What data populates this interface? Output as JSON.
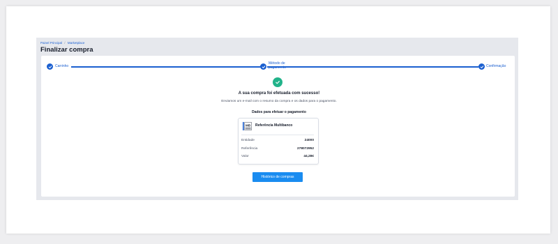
{
  "breadcrumb": {
    "items": [
      "Painel Principal",
      "Marketplace"
    ],
    "separator": "/"
  },
  "page_title": "Finalizar compra",
  "stepper": {
    "steps": [
      {
        "label": "Carrinho",
        "status": "complete"
      },
      {
        "label_line1": "Método de",
        "label_line2": "pagamento",
        "status": "complete"
      },
      {
        "label": "Confirmação",
        "status": "complete"
      }
    ],
    "accent_color": "#1a5fd0"
  },
  "success": {
    "title": "A sua compra foi efetuada com sucesso!",
    "subtitle": "Enviamos um e-mail com o resumo da compra e os dados para o pagamento.",
    "icon_color": "#22b38a"
  },
  "payment": {
    "section_title": "Dados para efetuar o pagamento",
    "method_logo_text": "MB",
    "method_name": "Referência Multibanco",
    "rows": [
      {
        "label": "Entidade",
        "value": "24000"
      },
      {
        "label": "Referência",
        "value": "278072952"
      },
      {
        "label": "Valor",
        "value": "44,28€"
      }
    ]
  },
  "actions": {
    "history_button_label": "Histórico de compras",
    "button_color": "#1a8cf0"
  }
}
